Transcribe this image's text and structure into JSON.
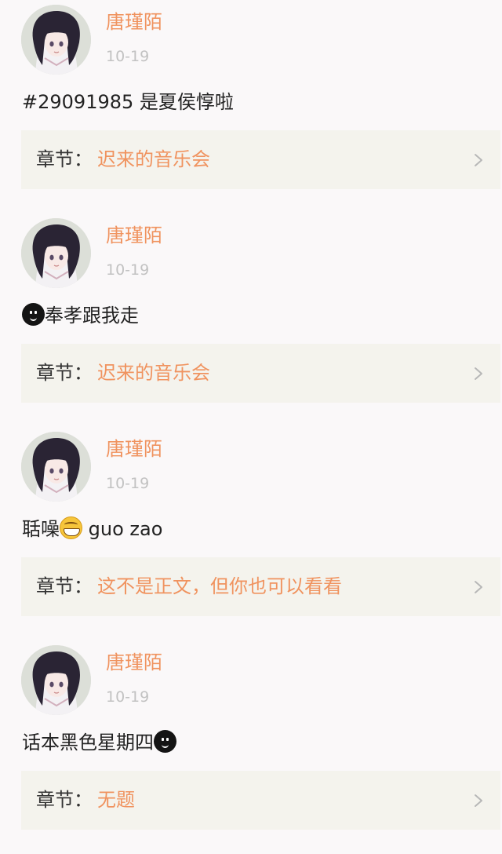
{
  "comments": [
    {
      "username": "唐瑾陌",
      "date": "10-19",
      "text_before": "#29091985 是夏侯惇啦",
      "emoji": "",
      "text_after": "",
      "chapter_prefix": "章节：",
      "chapter_title": "迟来的音乐会"
    },
    {
      "username": "唐瑾陌",
      "date": "10-19",
      "text_before": "",
      "emoji": "dark-face-emoji",
      "text_after": "奉孝跟我走",
      "chapter_prefix": "章节：",
      "chapter_title": "迟来的音乐会"
    },
    {
      "username": "唐瑾陌",
      "date": "10-19",
      "text_before": "聒噪",
      "emoji": "grinning-face-emoji",
      "text_after": " guo zao",
      "chapter_prefix": "章节：",
      "chapter_title": "这不是正文，但你也可以看看"
    },
    {
      "username": "唐瑾陌",
      "date": "10-19",
      "text_before": "话本黑色星期四",
      "emoji": "dark-face-emoji",
      "text_after": "",
      "chapter_prefix": "章节：",
      "chapter_title": "无题"
    }
  ],
  "icons": {
    "avatar": "anime-girl-avatar",
    "chevron": "chevron-right-icon"
  },
  "colors": {
    "accent": "#f0935f",
    "date": "#c2c2c2",
    "card_background": "#f4f3ed",
    "page_background": "#faf8f9"
  }
}
